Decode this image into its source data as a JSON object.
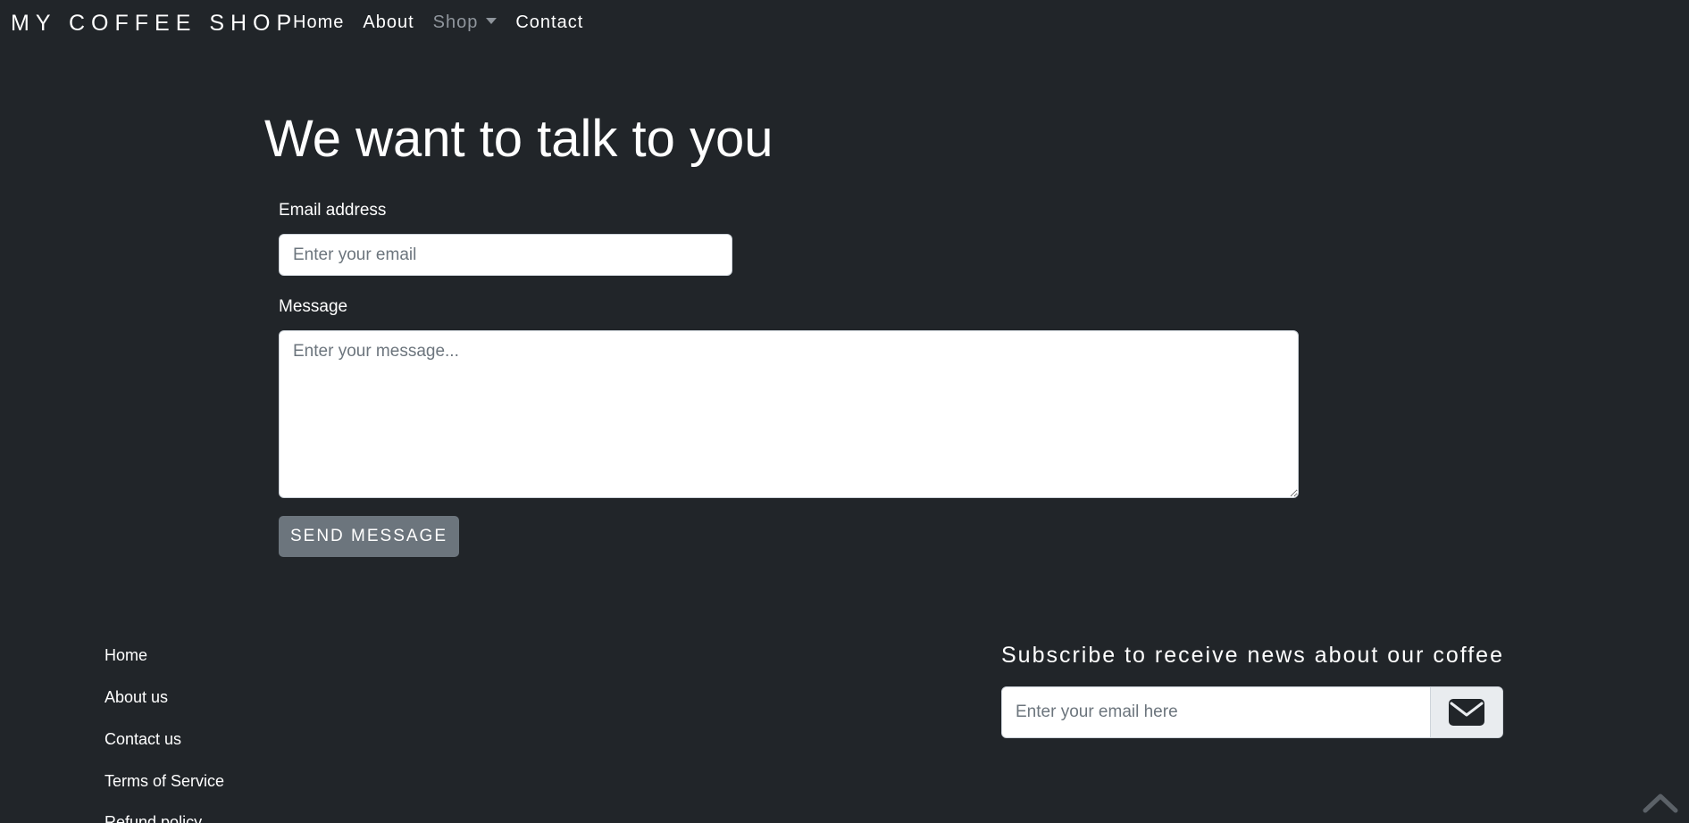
{
  "navbar": {
    "brand": "MY COFFEE SHOP",
    "links": [
      {
        "label": "Home"
      },
      {
        "label": "About"
      },
      {
        "label": "Shop"
      },
      {
        "label": "Contact"
      }
    ]
  },
  "contact": {
    "heading": "We want to talk to you",
    "email_label": "Email address",
    "email_placeholder": "Enter your email",
    "message_label": "Message",
    "message_placeholder": "Enter your message...",
    "send_label": "SEND MESSAGE"
  },
  "footer": {
    "links": [
      "Home",
      "About us",
      "Contact us",
      "Terms of Service",
      "Refund policy"
    ],
    "subscribe_title": "Subscribe to receive news about our coffee",
    "subscribe_placeholder": "Enter your email here",
    "subscribe_icon": "envelope-icon",
    "scroll_top_icon": "chevron-up-icon"
  },
  "colors": {
    "background": "#212529",
    "button": "#6c757d",
    "muted_link": "#8f959c"
  }
}
